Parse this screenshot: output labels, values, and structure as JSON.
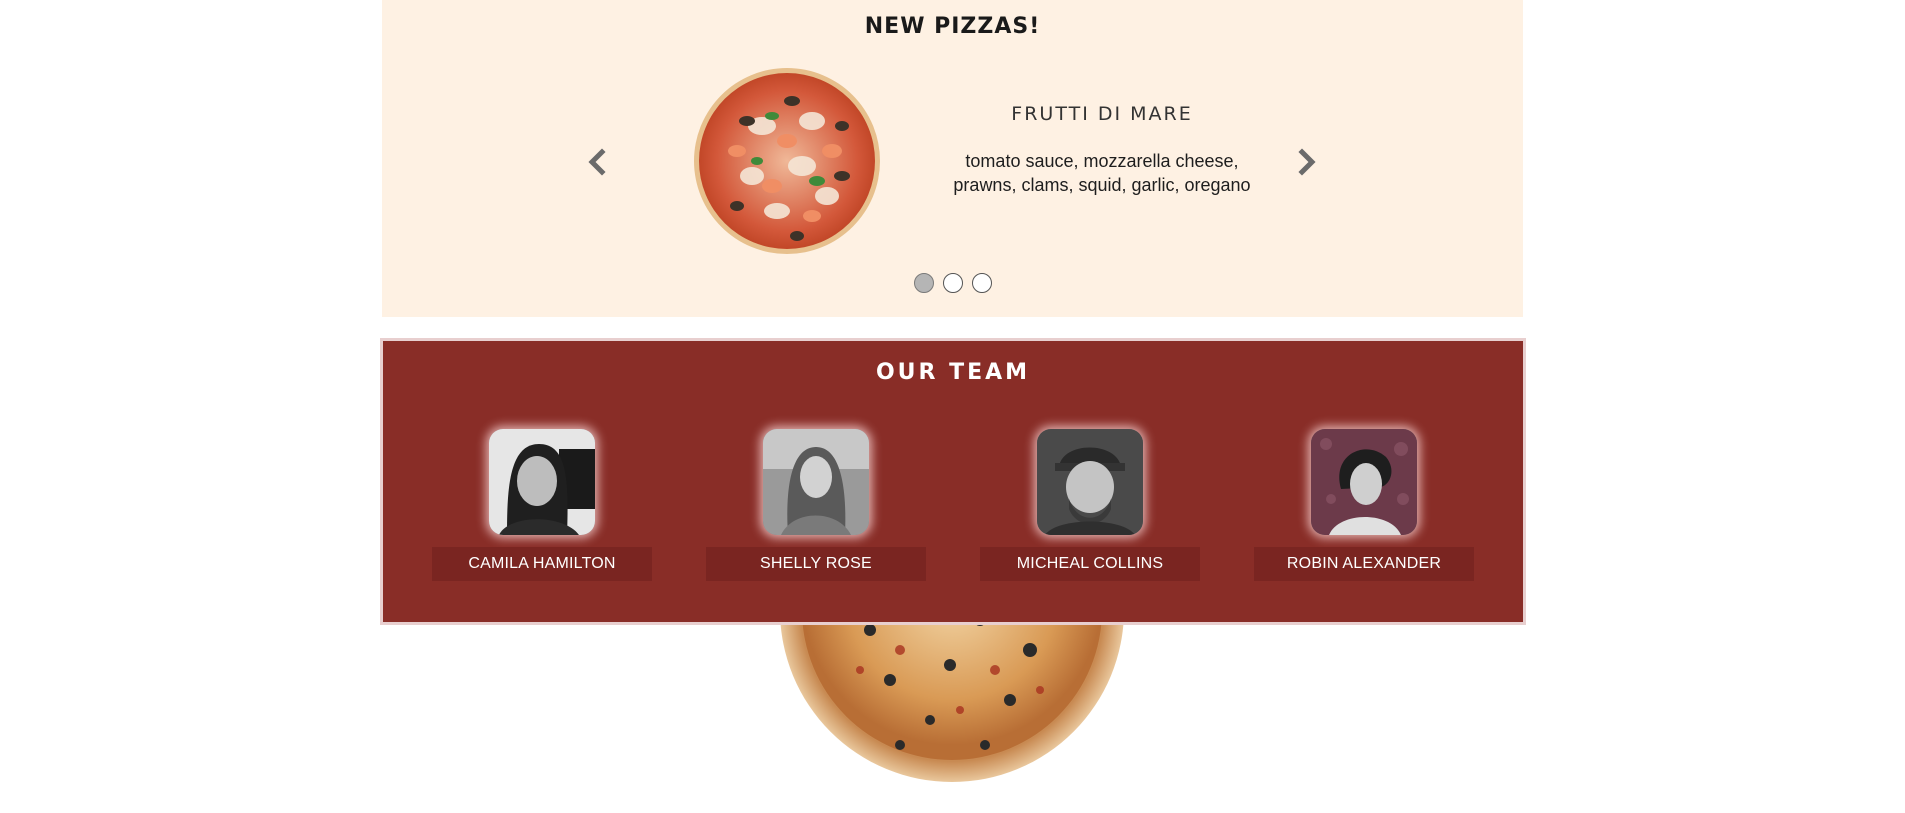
{
  "new_pizzas": {
    "title": "NEW PIZZAS!",
    "prev_icon": "chevron-left-icon",
    "next_icon": "chevron-right-icon",
    "current_slide": {
      "name": "FRUTTI DI MARE",
      "description": "tomato sauce, mozzarella cheese, prawns, clams, squid, garlic, oregano"
    },
    "slide_count": 3,
    "active_slide_index": 0
  },
  "our_team": {
    "title": "OUR TEAM",
    "members": [
      {
        "name": "CAMILA HAMILTON"
      },
      {
        "name": "SHELLY ROSE"
      },
      {
        "name": "MICHEAL COLLINS"
      },
      {
        "name": "ROBIN ALEXANDER"
      }
    ]
  },
  "colors": {
    "carousel_bg": "#fef1e3",
    "team_bg": "#892d27",
    "name_bar_bg": "#7a2521"
  }
}
